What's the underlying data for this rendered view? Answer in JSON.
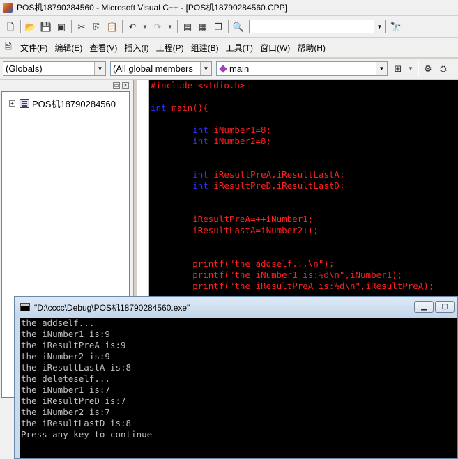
{
  "window": {
    "title": "POS机18790284560 - Microsoft Visual C++ - [POS机18790284560.CPP]"
  },
  "toolbar": {
    "buttons": [
      "new-file-icon",
      "open-folder-icon",
      "save-icon",
      "save-all-icon",
      "cut-icon",
      "copy-icon",
      "paste-icon",
      "undo-icon",
      "redo-icon",
      "workspace-icon",
      "output-icon",
      "window-list-icon",
      "find-in-files-icon",
      "find-icon"
    ],
    "find_value": ""
  },
  "menu": {
    "items": [
      "文件(F)",
      "编辑(E)",
      "查看(V)",
      "插入(I)",
      "工程(P)",
      "组建(B)",
      "工具(T)",
      "窗口(W)",
      "帮助(H)"
    ]
  },
  "wizard": {
    "scope": "(Globals)",
    "members": "(All global members",
    "function": "main"
  },
  "workspace": {
    "project": "POS机18790284560"
  },
  "editor": {
    "lines": [
      [
        {
          "t": "#include <stdio.h>",
          "c": "id"
        }
      ],
      [],
      [
        {
          "t": "int",
          "c": "kw"
        },
        {
          "t": " main(){",
          "c": "id"
        }
      ],
      [],
      [
        {
          "t": "        ",
          "c": "id"
        },
        {
          "t": "int",
          "c": "kw"
        },
        {
          "t": " iNumber1=8;",
          "c": "id"
        }
      ],
      [
        {
          "t": "        ",
          "c": "id"
        },
        {
          "t": "int",
          "c": "kw"
        },
        {
          "t": " iNumber2=8;",
          "c": "id"
        }
      ],
      [],
      [],
      [
        {
          "t": "        ",
          "c": "id"
        },
        {
          "t": "int",
          "c": "kw"
        },
        {
          "t": " iResultPreA,iResultLastA;",
          "c": "id"
        }
      ],
      [
        {
          "t": "        ",
          "c": "id"
        },
        {
          "t": "int",
          "c": "kw"
        },
        {
          "t": " iResultPreD,iResultLastD;",
          "c": "id"
        }
      ],
      [],
      [],
      [
        {
          "t": "        iResultPreA=++iNumber1;",
          "c": "id"
        }
      ],
      [
        {
          "t": "        iResultLastA=iNumber2++;",
          "c": "id"
        }
      ],
      [],
      [],
      [
        {
          "t": "        printf(\"the addself...\\n\");",
          "c": "id"
        }
      ],
      [
        {
          "t": "        printf(\"the iNumber1 is:%d\\n\",iNumber1);",
          "c": "id"
        }
      ],
      [
        {
          "t": "        printf(\"the iResultPreA is:%d\\n\",iResultPreA);",
          "c": "id"
        }
      ]
    ]
  },
  "console": {
    "title": "\"D:\\cccc\\Debug\\POS机18790284560.exe\"",
    "lines": [
      "the addself...",
      "the iNumber1 is:9",
      "the iResultPreA is:9",
      "the iNumber2 is:9",
      "the iResultLastA is:8",
      "the deleteself...",
      "the iNumber1 is:7",
      "the iResultPreD is:7",
      "the iNumber2 is:7",
      "the iResultLastD is:8",
      "Press any key to continue"
    ]
  }
}
